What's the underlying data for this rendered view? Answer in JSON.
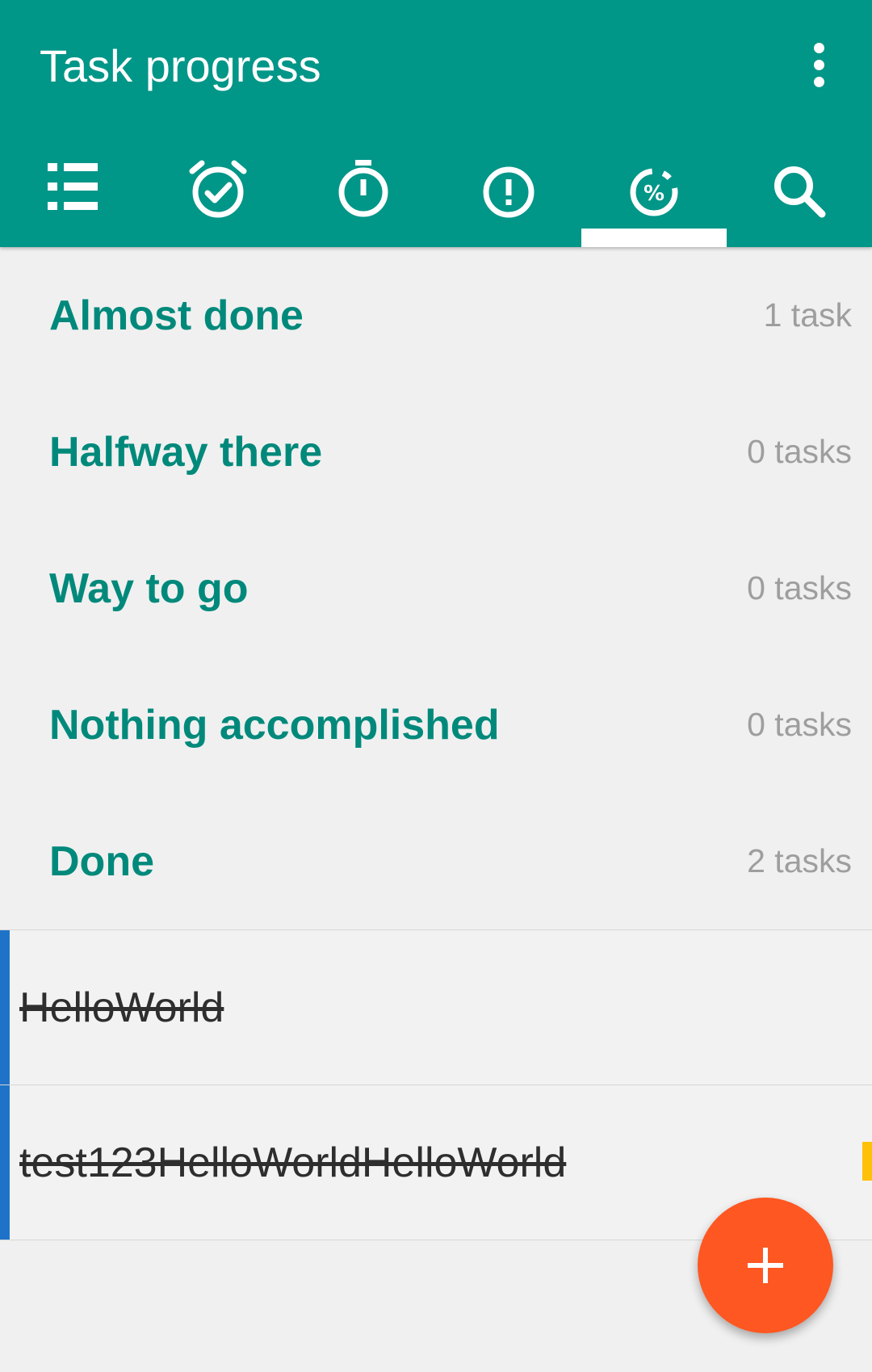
{
  "app_bar": {
    "title": "Task progress",
    "background_color": "#009688",
    "menu_icon": "more-vert-icon"
  },
  "tabs": [
    {
      "icon": "list-icon",
      "selected": false
    },
    {
      "icon": "alarm-check-icon",
      "selected": false
    },
    {
      "icon": "stopwatch-icon",
      "selected": false
    },
    {
      "icon": "priority-alert-icon",
      "selected": false
    },
    {
      "icon": "progress-percent-icon",
      "selected": true
    },
    {
      "icon": "search-icon",
      "selected": false
    }
  ],
  "groups": [
    {
      "title": "Almost done",
      "count": "1 task"
    },
    {
      "title": "Halfway there",
      "count": "0 tasks"
    },
    {
      "title": "Way to go",
      "count": "0 tasks"
    },
    {
      "title": "Nothing accomplished",
      "count": "0 tasks"
    },
    {
      "title": "Done",
      "count": "2 tasks"
    }
  ],
  "tasks": [
    {
      "name": "HelloWorld",
      "color": "#1e73c8",
      "completed": true
    },
    {
      "name": "test123HelloWorldHelloWorld",
      "color": "#1e73c8",
      "completed": true,
      "flag_color": "#ffc107"
    }
  ],
  "fab": {
    "icon": "add-icon",
    "color": "#ff5722"
  }
}
